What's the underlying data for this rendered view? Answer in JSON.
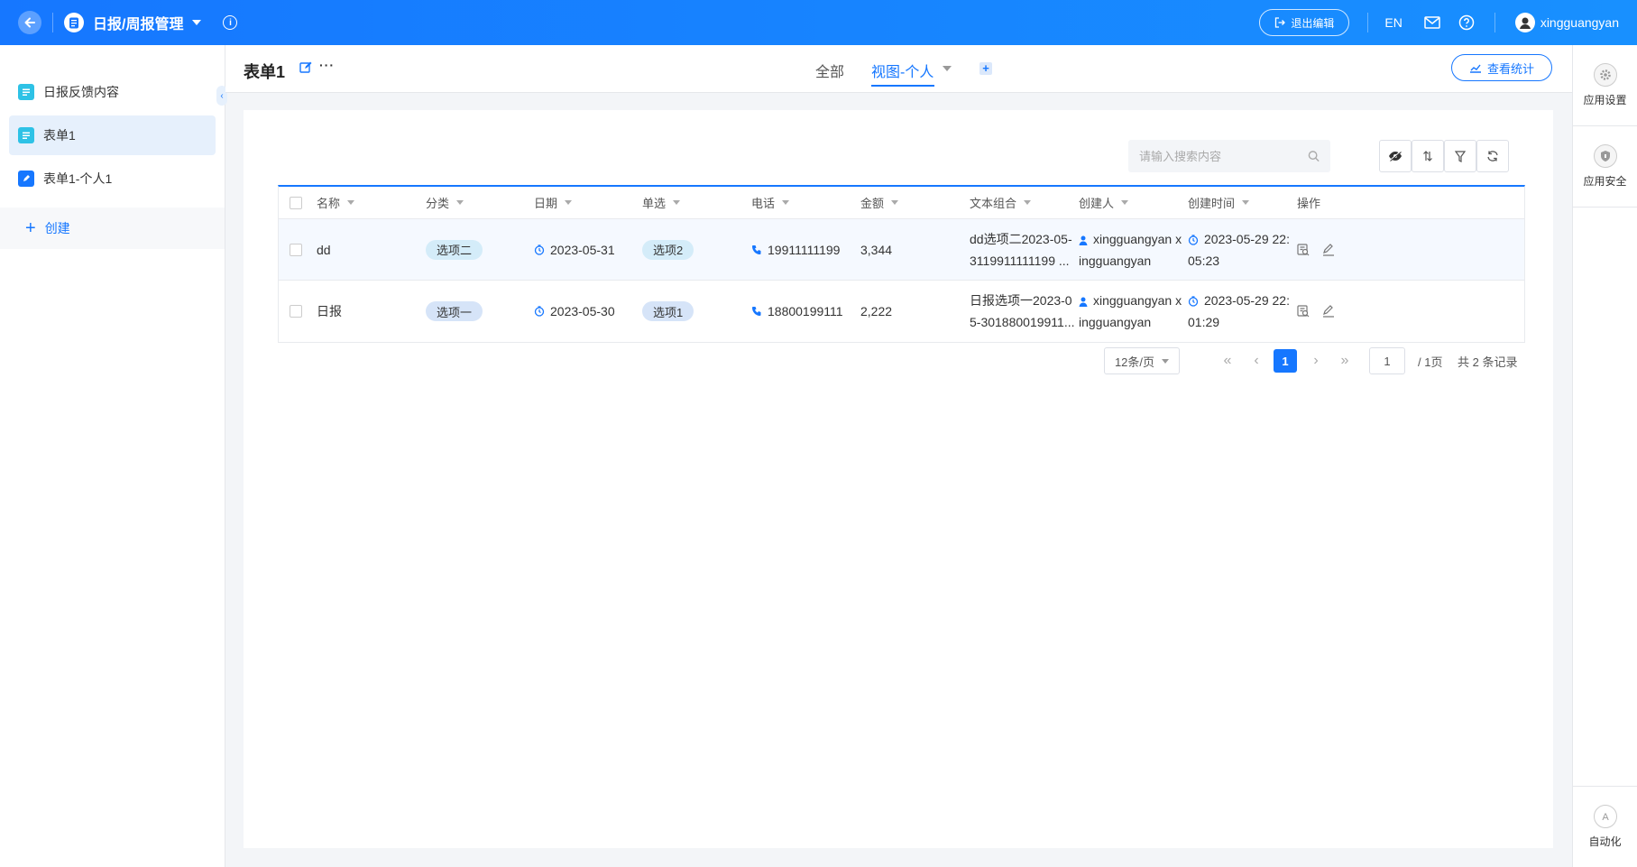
{
  "topbar": {
    "app_title": "日报/周报管理",
    "exit_edit_label": "退出编辑",
    "lang_label": "EN",
    "username": "xingguangyan"
  },
  "sidebar": {
    "items": [
      {
        "label": "日报反馈内容",
        "icon": "form-icon",
        "active": false
      },
      {
        "label": "表单1",
        "icon": "form-icon",
        "active": true
      },
      {
        "label": "表单1-个人1",
        "icon": "edit-form-icon",
        "active": false
      }
    ],
    "create_label": "创建"
  },
  "main": {
    "form_title": "表单1",
    "tabs": [
      {
        "label": "全部",
        "active": false
      },
      {
        "label": "视图-个人",
        "active": true
      }
    ],
    "stats_button_label": "查看统计"
  },
  "rightbar": {
    "app_settings_label": "应用设置",
    "app_security_label": "应用安全",
    "automation_label": "自动化"
  },
  "toolbar": {
    "search_placeholder": "请输入搜索内容"
  },
  "table": {
    "columns": [
      "名称",
      "分类",
      "日期",
      "单选",
      "电话",
      "金额",
      "文本组合",
      "创建人",
      "创建时间",
      "操作"
    ],
    "rows": [
      {
        "name": "dd",
        "category": "选项二",
        "date": "2023-05-31",
        "single": "选项2",
        "phone": "19911111199",
        "amount": "3,344",
        "text_combo_line1": "dd选项二2023-05-",
        "text_combo_line2": "3119911111199 ...",
        "creator_line1": "xingguangyan x",
        "creator_line2": "ingguangyan",
        "created_line1": "2023-05-29 22:",
        "created_line2": "05:23"
      },
      {
        "name": "日报",
        "category": "选项一",
        "date": "2023-05-30",
        "single": "选项1",
        "phone": "18800199111",
        "amount": "2,222",
        "text_combo_line1": "日报选项一2023-0",
        "text_combo_line2": "5-301880019911...",
        "creator_line1": "xingguangyan x",
        "creator_line2": "ingguangyan",
        "created_line1": "2023-05-29 22:",
        "created_line2": "01:29"
      }
    ]
  },
  "pagination": {
    "page_size": "12条/页",
    "current_page": "1",
    "page_input": "1",
    "total_pages": "/ 1页",
    "total_records": "共 2 条记录"
  },
  "colors": {
    "accent": "#1677ff",
    "tag_blue": "#d4ecf9",
    "tag_violet": "#d6e4f8"
  }
}
